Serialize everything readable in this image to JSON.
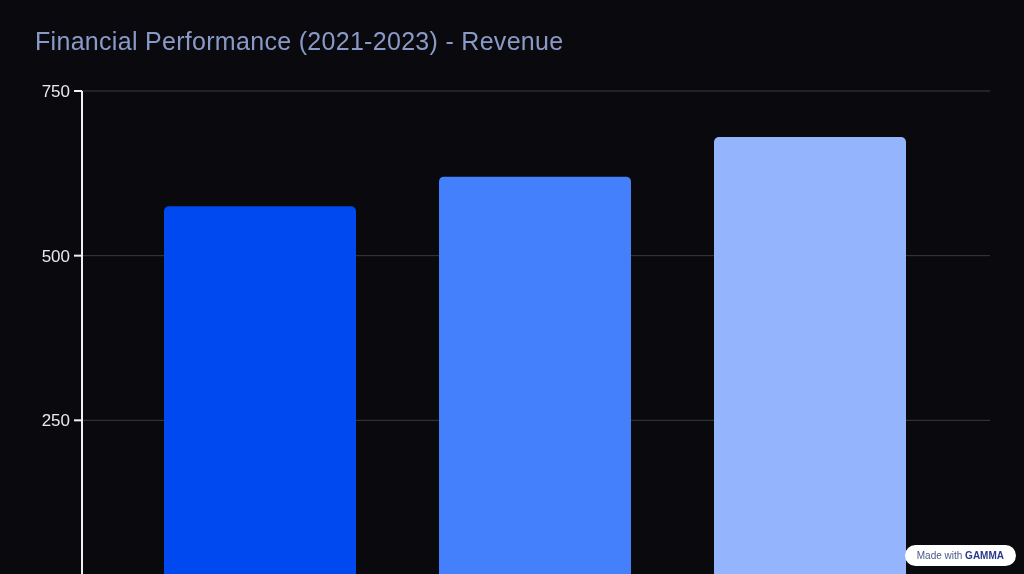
{
  "slide": {
    "title": "Financial Performance (2021-2023) - Revenue",
    "chart_data": {
      "type": "bar",
      "ylim": [
        0,
        750
      ],
      "yticks": [
        250,
        500,
        750
      ],
      "series": [
        {
          "color": "#0048f0",
          "values": [
            575,
            null,
            null
          ]
        },
        {
          "color": "#4580fc",
          "values": [
            null,
            620,
            null
          ]
        },
        {
          "color": "#94b4fd",
          "values": [
            null,
            null,
            680
          ]
        }
      ]
    }
  },
  "badge": {
    "text": "Made with",
    "brand": "GAMMA"
  }
}
